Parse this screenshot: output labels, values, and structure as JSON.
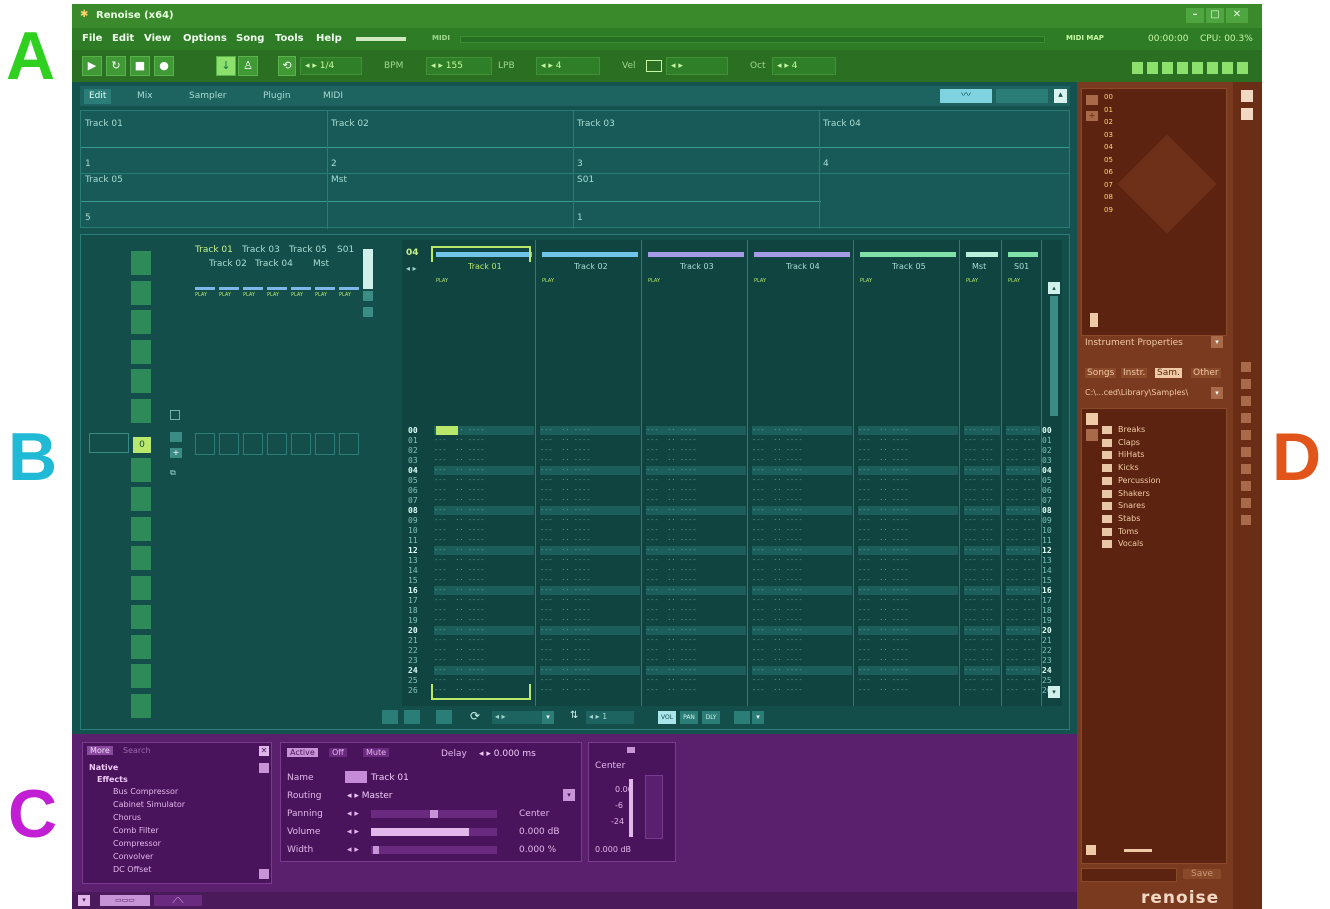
{
  "annotations": {
    "a": "A",
    "b": "B",
    "c": "C",
    "d": "D"
  },
  "colors": {
    "a": "#2fd020",
    "b": "#20b9d6",
    "c": "#c21fd4",
    "d": "#e2551a"
  },
  "title": "Renoise (x64)",
  "menu": [
    "File",
    "Edit",
    "View",
    "Options",
    "Song",
    "Tools",
    "Help"
  ],
  "status": {
    "midi": "MIDI",
    "midi_map": "MIDI MAP",
    "time": "00:00:00",
    "cpu": "CPU: 00.3%"
  },
  "transport": {
    "loop_value": "◂ ▸ 1/4",
    "bpm_label": "BPM",
    "bpm_value": "◂ ▸ 155",
    "lpb_label": "LPB",
    "lpb_value": "◂ ▸ 4",
    "vel_label": "Vel",
    "vel_value": "◂ ▸",
    "oct_label": "Oct",
    "oct_value": "◂ ▸ 4"
  },
  "upper_tabs": [
    "Edit",
    "Mix",
    "Sampler",
    "Plugin",
    "MIDI"
  ],
  "matrix": {
    "tracks_row1": [
      "Track 01",
      "Track 02",
      "Track 03",
      "Track 04"
    ],
    "nums_row1": [
      "1",
      "2",
      "3",
      "4"
    ],
    "tracks_row2": [
      "Track 05",
      "Mst",
      "S01"
    ],
    "nums_row2": [
      "5",
      "1"
    ]
  },
  "mini_tracks": {
    "top": [
      "Track 01",
      "Track 03",
      "Track 05",
      "S01"
    ],
    "bottom": [
      "Track 02",
      "Track 04",
      "Mst"
    ]
  },
  "pattern": {
    "number": "04",
    "tracks": [
      "Track 01",
      "Track 02",
      "Track 03",
      "Track 04",
      "Track 05",
      "Mst",
      "S01"
    ],
    "play": "PLAY",
    "rows": [
      "00",
      "01",
      "02",
      "03",
      "04",
      "05",
      "06",
      "07",
      "08",
      "09",
      "10",
      "11",
      "12",
      "13",
      "14",
      "15",
      "16",
      "17",
      "18",
      "19",
      "20",
      "21",
      "22",
      "23",
      "24",
      "25",
      "26"
    ],
    "bottom": {
      "vol": "VOL",
      "pan": "PAN",
      "dly": "DLY",
      "page_value": "◂ ▸ 1"
    }
  },
  "dsp_browser": {
    "more": "More",
    "search": "Search",
    "native": "Native",
    "effects": "Effects",
    "items": [
      "Bus Compressor",
      "Cabinet Simulator",
      "Chorus",
      "Comb Filter",
      "Compressor",
      "Convolver",
      "DC Offset"
    ]
  },
  "track_props": {
    "active": "Active",
    "off": "Off",
    "mute": "Mute",
    "delay_label": "Delay",
    "delay_value": "◂ ▸ 0.000 ms",
    "name_label": "Name",
    "name_value": "Track 01",
    "routing_label": "Routing",
    "routing_value": "◂ ▸ Master",
    "panning_label": "Panning",
    "panning_value": "Center",
    "volume_label": "Volume",
    "volume_value": "0.000 dB",
    "width_label": "Width",
    "width_value": "0.000 %",
    "volume_level": 0.78,
    "panning_level": 0.5
  },
  "meter": {
    "center": "Center",
    "db_top": "0.00",
    "db_mid": "-6",
    "db_low": "-24",
    "db_bottom": "0.000 dB"
  },
  "instrument": {
    "list": [
      "00",
      "01",
      "02",
      "03",
      "04",
      "05",
      "06",
      "07",
      "08",
      "09"
    ],
    "properties": "Instrument Properties"
  },
  "disk_browser": {
    "tabs": [
      "Songs",
      "Instr.",
      "Sam.",
      "Other"
    ],
    "path": "C:\\...ced\\Library\\Samples\\",
    "folders": [
      "Breaks",
      "Claps",
      "HiHats",
      "Kicks",
      "Percussion",
      "Shakers",
      "Snares",
      "Stabs",
      "Toms",
      "Vocals"
    ],
    "save": "Save",
    "logo": "renoise"
  }
}
